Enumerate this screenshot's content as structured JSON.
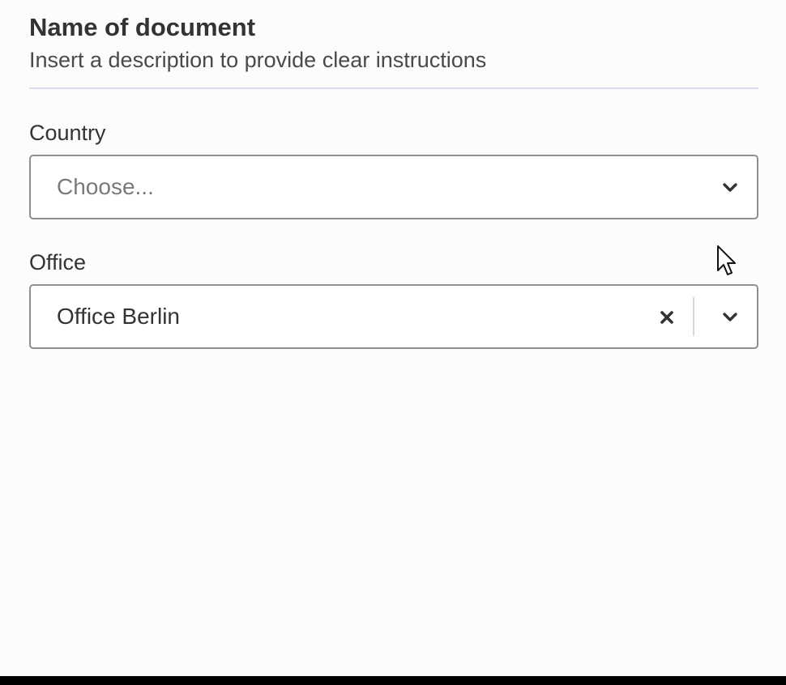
{
  "document": {
    "title": "Name of document",
    "description": "Insert a description to provide clear instructions"
  },
  "fields": {
    "country": {
      "label": "Country",
      "placeholder": "Choose...",
      "value": "",
      "icons": [
        "chevron-down-icon"
      ]
    },
    "office": {
      "label": "Office",
      "placeholder": "",
      "value": "Office Berlin",
      "icons": [
        "clear-icon",
        "chevron-down-icon"
      ]
    }
  },
  "colors": {
    "background": "#fdfcfb",
    "text": "#333333",
    "placeholder": "#7a7a7a",
    "border": "#8f8f8f",
    "divider": "#dcdcec"
  },
  "cursor": {
    "icon": "mouse-pointer-icon"
  }
}
